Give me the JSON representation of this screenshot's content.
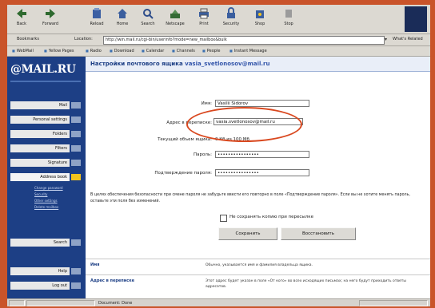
{
  "toolbar": {
    "buttons": [
      {
        "label": "Back",
        "icon": "back-arrow-icon"
      },
      {
        "label": "Forward",
        "icon": "forward-arrow-icon"
      },
      {
        "label": "Reload",
        "icon": "reload-icon"
      },
      {
        "label": "Home",
        "icon": "home-icon"
      },
      {
        "label": "Search",
        "icon": "search-icon"
      },
      {
        "label": "Netscape",
        "icon": "netscape-icon"
      },
      {
        "label": "Print",
        "icon": "print-icon"
      },
      {
        "label": "Security",
        "icon": "lock-icon"
      },
      {
        "label": "Shop",
        "icon": "shop-icon"
      },
      {
        "label": "Stop",
        "icon": "stop-icon"
      }
    ]
  },
  "address_bar": {
    "bookmarks_label": "Bookmarks",
    "location_label": "Location:",
    "url": "http://win.mail.ru/cgi-bin/userinfo?mode=new_mailbox&bulk",
    "whats_related": "What's Related"
  },
  "personal_toolbar": {
    "links": [
      "WebMail",
      "Yellow Pages",
      "Radio",
      "Download",
      "Calendar",
      "Channels",
      "People",
      "Instant Message"
    ]
  },
  "sidebar": {
    "logo": "@MAIL.RU",
    "items": [
      {
        "label": "Mail"
      },
      {
        "label": "Personal settings"
      },
      {
        "label": "Folders"
      },
      {
        "label": "Filters"
      },
      {
        "label": "Signature"
      },
      {
        "label": "Address book",
        "active": true
      },
      {
        "label": "Search"
      },
      {
        "label": "Help"
      },
      {
        "label": "Log out"
      }
    ],
    "links": [
      "Change password",
      "Security",
      "Other settings",
      "Delete mailbox"
    ]
  },
  "page": {
    "title": "Настройки почтового ящика",
    "email": "vasia_svetlonosov@mail.ru",
    "form": {
      "name_label": "Имя:",
      "name_value": "Vasilii Sidorov",
      "address_label": "Адрес в переписке:",
      "address_value": "vasia.svetlonosov@mail.ru",
      "mailbox_size_label": "Текущий объем ящика:",
      "mailbox_size_value": "0 Кб из 100 Мб",
      "password_label": "Пароль:",
      "password_value": "••••••••••••••••",
      "confirm_label": "Подтверждение пароля:",
      "confirm_value": "••••••••••••••••"
    },
    "notice": "В целях обеспечения безопасности при смене пароля не забудьте ввести его повторно в поле «Подтверждение пароля». Если вы не хотите менять пароль, оставьте эти поля без изменений.",
    "checkbox_label": "Не сохранять копию при пересылке",
    "save_button": "Сохранить",
    "restore_button": "Восстановить",
    "help": [
      {
        "term": "Имя",
        "desc": "Обычно, указывается имя и фамилия владельца ящика."
      },
      {
        "term": "Адрес в переписке",
        "desc": "Этот адрес будет указан в поле «От кого» во всех исходящих письмах; на него будут приходить ответы адресатов."
      }
    ]
  },
  "statusbar": {
    "text": "Document: Done"
  },
  "colors": {
    "sidebar": "#1d3f85",
    "highlight": "#d9481f",
    "active_nav": "#f2c31d"
  }
}
